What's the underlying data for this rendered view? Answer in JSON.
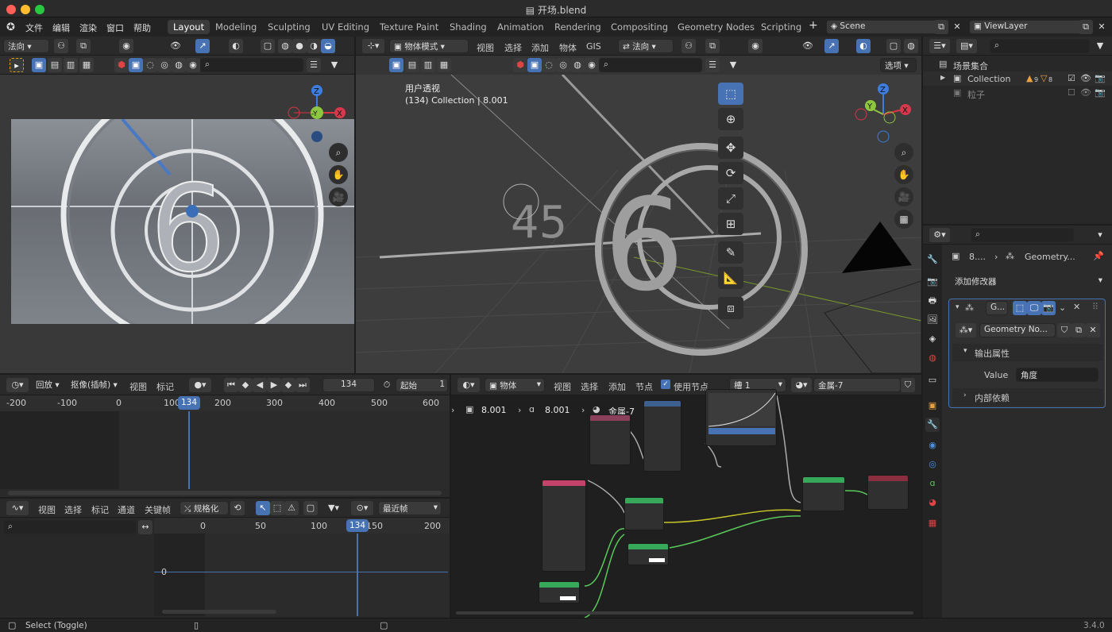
{
  "window": {
    "title": "开场.blend"
  },
  "menus": [
    "文件",
    "编辑",
    "渲染",
    "窗口",
    "帮助"
  ],
  "workspaces": [
    "Layout",
    "Modeling",
    "Sculpting",
    "UV Editing",
    "Texture Paint",
    "Shading",
    "Animation",
    "Rendering",
    "Compositing",
    "Geometry Nodes",
    "Scripting"
  ],
  "active_workspace": "Layout",
  "scene": {
    "name": "Scene",
    "view_layer": "ViewLayer"
  },
  "left_viewport": {
    "shading": "法向"
  },
  "viewport3d": {
    "mode": "物体模式",
    "menus": [
      "视图",
      "选择",
      "添加",
      "物体",
      "GIS"
    ],
    "orientation": "法向",
    "view_name": "用户透视",
    "view_info": "(134) Collection | 8.001",
    "options_label": "选项",
    "gizmo_labels": {
      "z": "Z",
      "y": "Y",
      "x": "X",
      "neg_y": "-Y"
    },
    "scene_text": "45"
  },
  "outliner": {
    "root": "场景集合",
    "items": [
      {
        "name": "Collection",
        "badge1": "9",
        "badge2": "8"
      },
      {
        "name": "粒子"
      }
    ]
  },
  "properties": {
    "object_name": "8....",
    "modifier_name": "Geometry...",
    "add_modifier": "添加修改器",
    "modifier_short": "G...",
    "node_group": "Geometry No...",
    "output_section": "输出属性",
    "value_label": "Value",
    "value": "角度",
    "internal_deps": "内部依赖"
  },
  "timeline": {
    "playback": "回放",
    "keying": "抠像(插帧)",
    "view": "视图",
    "marker": "标记",
    "current_frame": "134",
    "start_label": "起始",
    "start_value": "1",
    "ruler": [
      "-200",
      "-100",
      "0",
      "100",
      "200",
      "300",
      "400",
      "500",
      "600"
    ]
  },
  "graph_editor": {
    "menus": [
      "视图",
      "选择",
      "标记",
      "通道",
      "关键帧"
    ],
    "normalize": "规格化",
    "nearest_frame": "最近帧",
    "ruler": [
      "0",
      "50",
      "100",
      "150",
      "200"
    ],
    "current_frame": "134",
    "zero_label": "0"
  },
  "node_editor": {
    "mode": "物体",
    "menus": [
      "视图",
      "选择",
      "添加",
      "节点"
    ],
    "use_nodes": "使用节点",
    "slot": "槽 1",
    "material": "金属-7",
    "breadcrumb": [
      "8.001",
      "8.001",
      "金属-7"
    ]
  },
  "status_bar": {
    "hint": "Select (Toggle)",
    "version": "3.4.0"
  },
  "colors": {
    "accent": "#4772b3",
    "header": "#2a2a2a",
    "bg": "#1d1d1d",
    "shader_node": "#35a85a",
    "texture_node": "#c4436a"
  }
}
